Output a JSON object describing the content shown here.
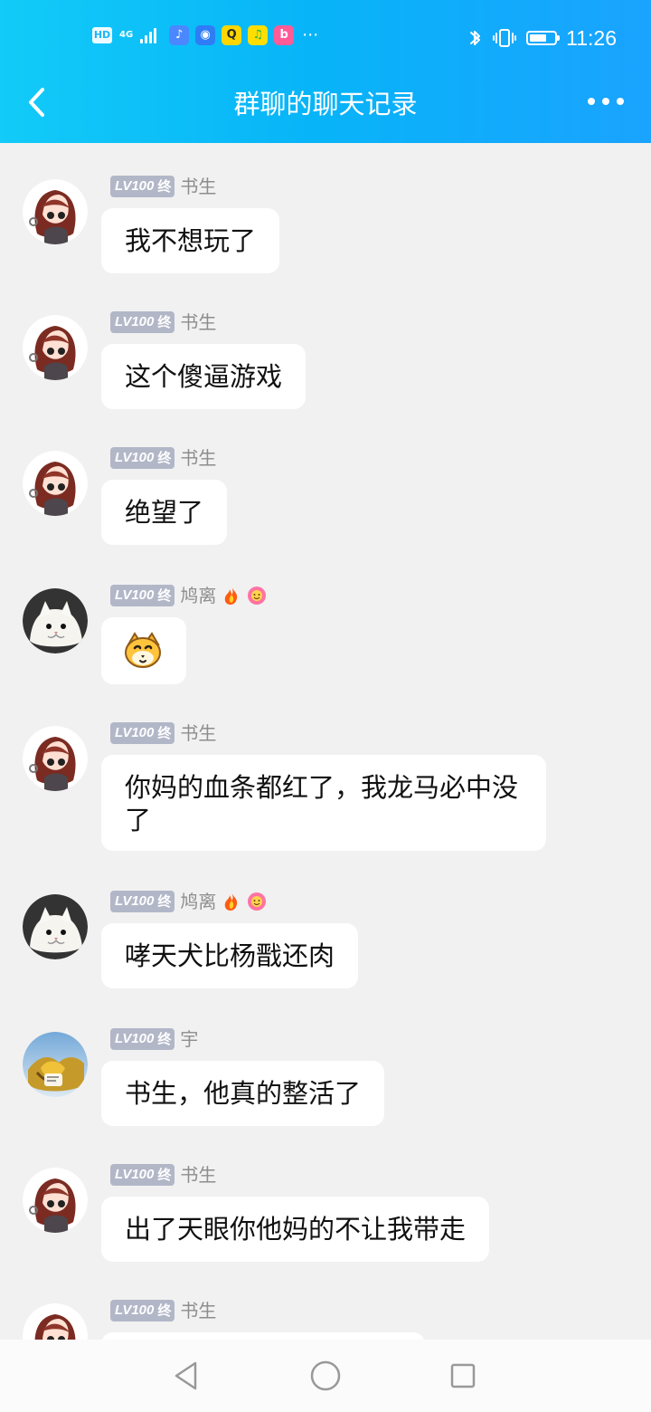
{
  "status_bar": {
    "hd": "HD",
    "network": "4G",
    "time": "11:26",
    "battery_level": 0.68
  },
  "header": {
    "title": "群聊的聊天记录"
  },
  "user_badge": {
    "level": "LV100",
    "mark": "终"
  },
  "messages": [
    {
      "sender": "书生",
      "text": "我不想玩了",
      "avatar_icon": "anime-girl-avatar-icon"
    },
    {
      "sender": "书生",
      "text": "这个傻逼游戏",
      "avatar_icon": "anime-girl-avatar-icon"
    },
    {
      "sender": "书生",
      "text": "绝望了",
      "avatar_icon": "anime-girl-avatar-icon"
    },
    {
      "sender": "鸠离",
      "text": "",
      "avatar_icon": "white-cat-avatar-icon",
      "medal_icons": [
        "fire-medal-icon",
        "pink-flower-medal-icon"
      ],
      "emoji_icon": "yellow-dog-emoji-icon"
    },
    {
      "sender": "书生",
      "text": "你妈的血条都红了，我龙马必中没了",
      "avatar_icon": "anime-girl-avatar-icon"
    },
    {
      "sender": "鸠离",
      "text": "哮天犬比杨戬还肉",
      "avatar_icon": "white-cat-avatar-icon",
      "medal_icons": [
        "fire-medal-icon",
        "pink-flower-medal-icon"
      ]
    },
    {
      "sender": "宇",
      "text": "书生，他真的整活了",
      "avatar_icon": "gold-figure-avatar-icon"
    },
    {
      "sender": "书生",
      "text": "出了天眼你他妈的不让我带走",
      "avatar_icon": "anime-girl-avatar-icon"
    },
    {
      "sender": "书生",
      "text": "",
      "avatar_icon": "anime-girl-avatar-icon"
    }
  ],
  "icons": {
    "back": "back-arrow-icon",
    "more": "more-options-icon",
    "nav_back": "triangle-back-icon",
    "nav_home": "circle-home-icon",
    "nav_recent": "square-recent-icon"
  },
  "colors": {
    "header_start": "#12cbf8",
    "header_end": "#1aa3ff",
    "chat_background": "#f1f1f1",
    "bubble": "#ffffff",
    "badge": "#b2b7c8"
  }
}
